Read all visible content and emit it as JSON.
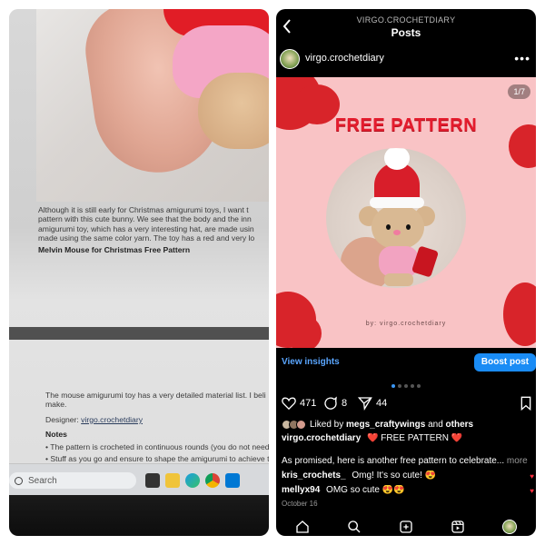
{
  "left_panel": {
    "article": {
      "paragraph_lines": [
        "Although it is still early for Christmas amigurumi toys, I want t",
        "pattern with this cute bunny. We see that the body and the inn",
        "amigurumi toy, which has a very interesting hat, are made usin",
        "made using the same color yarn. The toy has a red and very lo"
      ],
      "heading": "Melvin Mouse for Christmas Free Pattern",
      "material_lines": [
        "The mouse amigurumi toy has a very detailed material list. I beli",
        "make."
      ],
      "designer_label": "Designer:",
      "designer_link": "virgo.crochetdiary",
      "notes_heading": "Notes",
      "notes": [
        "• The pattern is crocheted in continuous rounds (you do not need",
        "• Stuff as you go and ensure to shape the amigurumi to achieve th"
      ]
    },
    "taskbar": {
      "search_placeholder": "Search"
    }
  },
  "right_panel": {
    "header": {
      "account": "VIRGO.CROCHETDIARY",
      "title": "Posts"
    },
    "post_author": "virgo.crochetdiary",
    "more_symbol": "•••",
    "image": {
      "counter": "1/7",
      "headline": "FREE PATTERN",
      "byline": "by: virgo.crochetdiary"
    },
    "view_insights": "View insights",
    "boost_post": "Boost post",
    "stats": {
      "likes": "471",
      "comments": "8",
      "shares": "44"
    },
    "liked_by": {
      "prefix": "Liked by ",
      "user": "megs_craftywings",
      "middle": " and ",
      "suffix": "others"
    },
    "caption": {
      "user": "virgo.crochetdiary",
      "text": "❤️ FREE PATTERN ❤️"
    },
    "description": {
      "text": "As promised, here is another free pattern to celebrate...",
      "more": "more"
    },
    "comments": [
      {
        "user": "kris_crochets_",
        "text": "Omg! It's so cute! 😍"
      },
      {
        "user": "mellyx94",
        "text": "OMG so cute 😍😍"
      }
    ],
    "date": "October 16",
    "colors": {
      "accent_blue": "#1a8cf5",
      "post_pink": "#f9c3c5",
      "title_red": "#e41c2d"
    }
  }
}
